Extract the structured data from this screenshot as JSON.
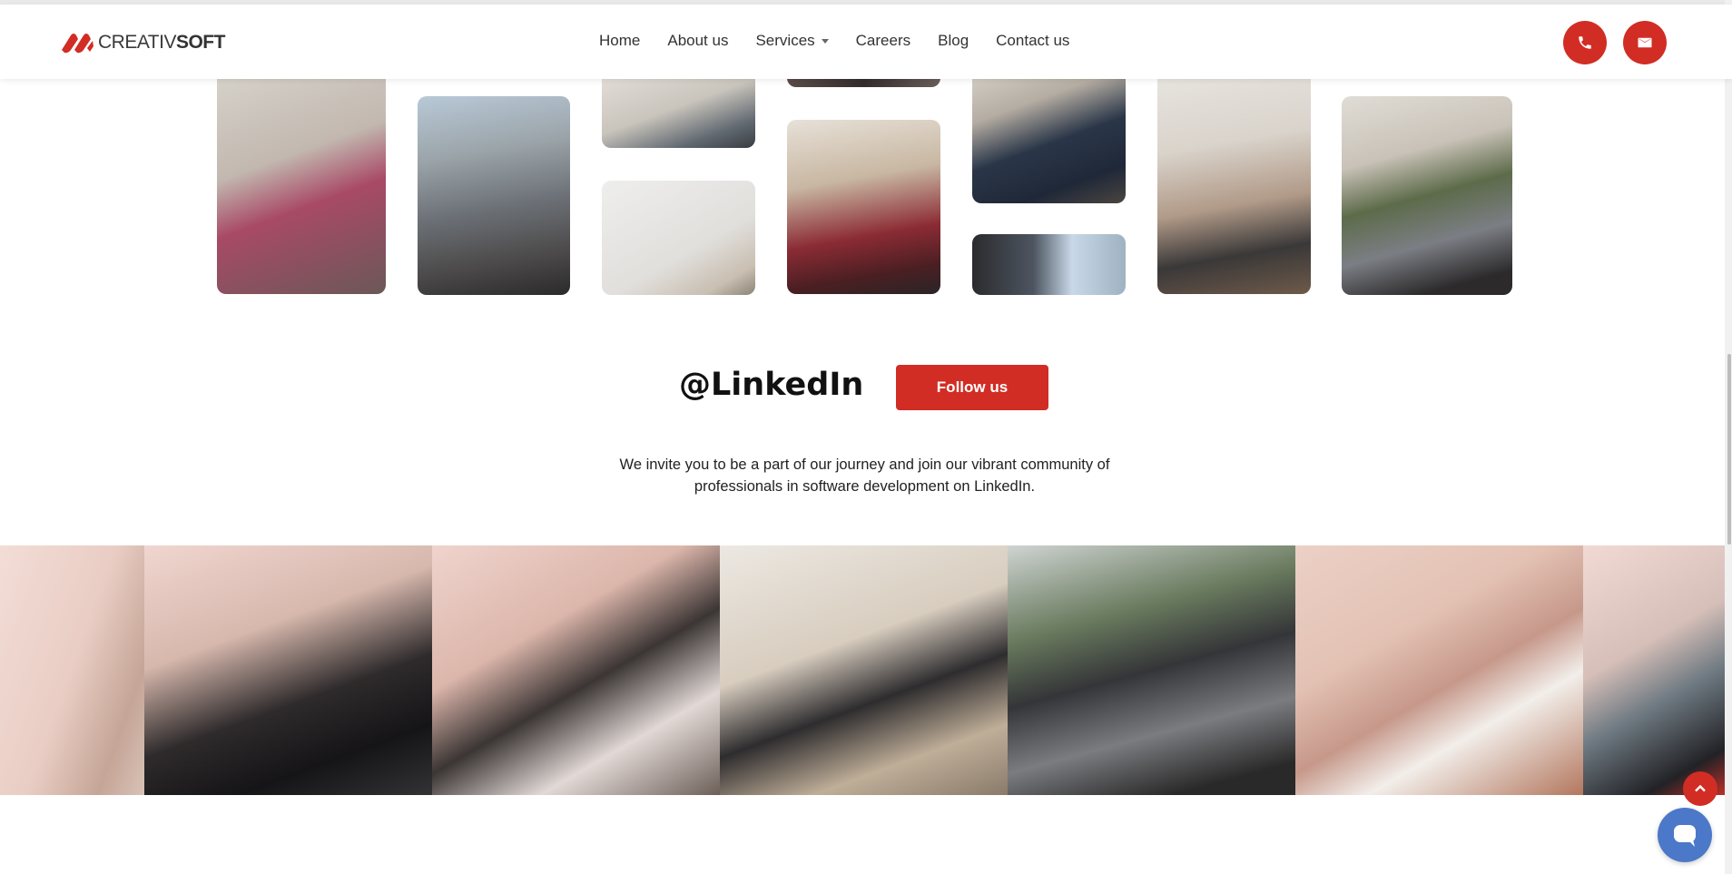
{
  "brand": {
    "name_regular": "CREATIV",
    "name_bold": "SOFT",
    "accent_color": "#d12d24"
  },
  "nav": {
    "items": [
      {
        "label": "Home"
      },
      {
        "label": "About us"
      },
      {
        "label": "Services",
        "has_dropdown": true
      },
      {
        "label": "Careers"
      },
      {
        "label": "Blog"
      },
      {
        "label": "Contact us"
      }
    ]
  },
  "header_actions": {
    "phone_icon": "phone-icon",
    "mail_icon": "mail-icon"
  },
  "linkedin": {
    "title": "@LinkedIn",
    "follow_label": "Follow us",
    "intro": "We invite you to be a part of our journey and join our vibrant community of professionals in software development on LinkedIn."
  },
  "floating": {
    "scroll_top_icon": "chevron-up-icon",
    "chat_icon": "chat-bubble-icon"
  }
}
